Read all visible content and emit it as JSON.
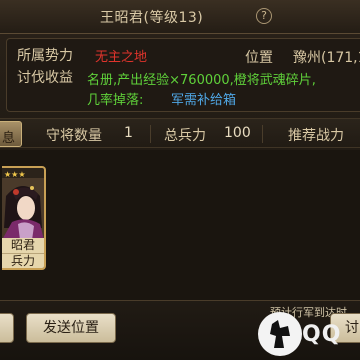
{
  "header": {
    "title": "王昭君(等级13)",
    "help_icon": "?"
  },
  "info": {
    "faction_label": "所属势力",
    "faction_value": "无主之地",
    "position_label": "位置",
    "position_value": "豫州(171,13",
    "reward_label": "讨伐收益",
    "reward_value": "名册,产出经验×760000,橙将武魂碎片,",
    "drop_label": "几率掉落:",
    "drop_value": "军需补给箱"
  },
  "stats": {
    "tab_label": "息",
    "guard_count_label": "守将数量",
    "guard_count_value": "1",
    "total_troops_label": "总兵力",
    "total_troops_value": "100",
    "recommended_power_label": "推荐战力"
  },
  "general_card": {
    "stars": "★★★",
    "name": "昭君",
    "stat": "兵力"
  },
  "bottom": {
    "march_note": "预计行军到达时",
    "left_button": "",
    "send_position_button": "发送位置",
    "right_button": "讨"
  },
  "watermark": {
    "text": "QQ"
  },
  "colors": {
    "faction_red": "#e0342c",
    "reward_green": "#5fd13a",
    "drop_blue": "#4fa7e6",
    "gold_border": "#c8a055"
  }
}
